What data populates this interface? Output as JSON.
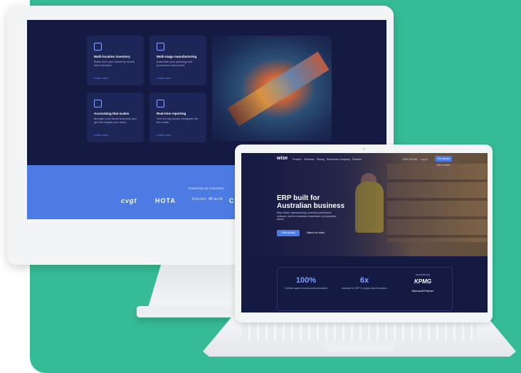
{
  "monitor": {
    "cards": [
      {
        "title": "Multi-location inventory",
        "desc": "Make sure your inventory meets meet demand.",
        "link": "Learn more"
      },
      {
        "title": "Multi-stage manufacturing",
        "desc": "Automate your planning and processes end-to-end.",
        "link": "Learn more"
      },
      {
        "title": "Accounting that scales",
        "desc": "Manage your whole business and get the insights you need.",
        "link": "Learn more"
      },
      {
        "title": "Real-time reporting",
        "desc": "See the big picture alongside the fine detail.",
        "link": "Learn more"
      }
    ],
    "trust_label": "Trusted by our customers",
    "logos": [
      "cvgt",
      "HOTA",
      "Doctor Wraith",
      "CV"
    ]
  },
  "laptop": {
    "brand": "wise",
    "nav_items": [
      "Product",
      "Solutions",
      "Pricing",
      "Resources",
      "Company",
      "Partners"
    ],
    "nav_phone": "1300 735 354",
    "nav_login": "Log in",
    "nav_cta": "Get started",
    "nav_lang": "Talk to sales",
    "hero_title": "ERP built for Australian business",
    "hero_sub": "Wise Sales, manufacturing, inventory and finance software, built for Australian businesses, by Australian teams.",
    "btn_primary": "View pricing",
    "btn_video": "Watch our video",
    "stats": [
      {
        "num": "100%",
        "cap": "Certified against cloud security standards"
      },
      {
        "num": "6x",
        "cap": "Awarded for ERP & supply chain innovation"
      }
    ],
    "partner_top": "Accredited by",
    "partner_logo": "KPMG",
    "partner_name": "Microsoft Partner"
  }
}
